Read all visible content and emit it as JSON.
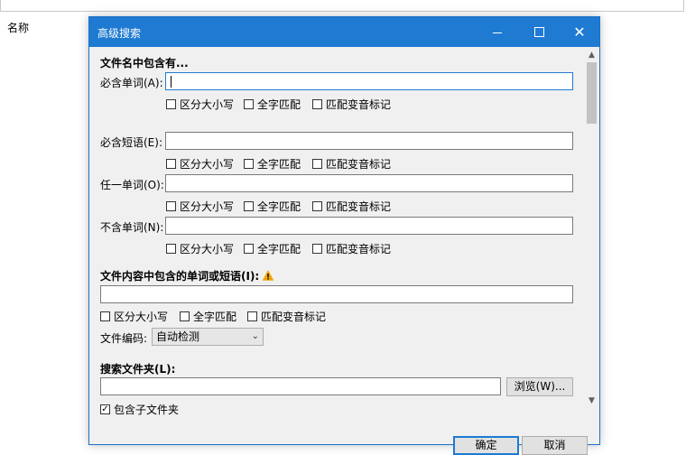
{
  "background": {
    "column_header": "名称"
  },
  "dialog": {
    "title": "高级搜索",
    "title_buttons": {
      "minimize": "minimize-icon",
      "maximize": "maximize-icon",
      "close": "✕"
    },
    "filename_section": {
      "title": "文件名中包含有...",
      "rows": [
        {
          "label": "必含单词(A):",
          "value": ""
        },
        {
          "label": "必含短语(E):",
          "value": ""
        },
        {
          "label": "任一单词(O):",
          "value": ""
        },
        {
          "label": "不含单词(N):",
          "value": ""
        }
      ],
      "options": [
        "区分大小写",
        "全字匹配",
        "匹配变音标记"
      ]
    },
    "content_section": {
      "title": "文件内容中包含的单词或短语(I):",
      "warning_icon": "warning-icon",
      "value": "",
      "options": [
        "区分大小写",
        "全字匹配",
        "匹配变音标记"
      ],
      "encoding_label": "文件编码:",
      "encoding_value": "自动检测"
    },
    "folder_section": {
      "title": "搜索文件夹(L):",
      "value": "",
      "browse_label": "浏览(W)...",
      "include_subfolders_label": "包含子文件夹",
      "include_subfolders_checked": true
    },
    "ok_label": "确定",
    "cancel_label": "取消"
  },
  "colors": {
    "accent": "#1f7ad2",
    "dialog_bg": "#f0f0f0"
  }
}
